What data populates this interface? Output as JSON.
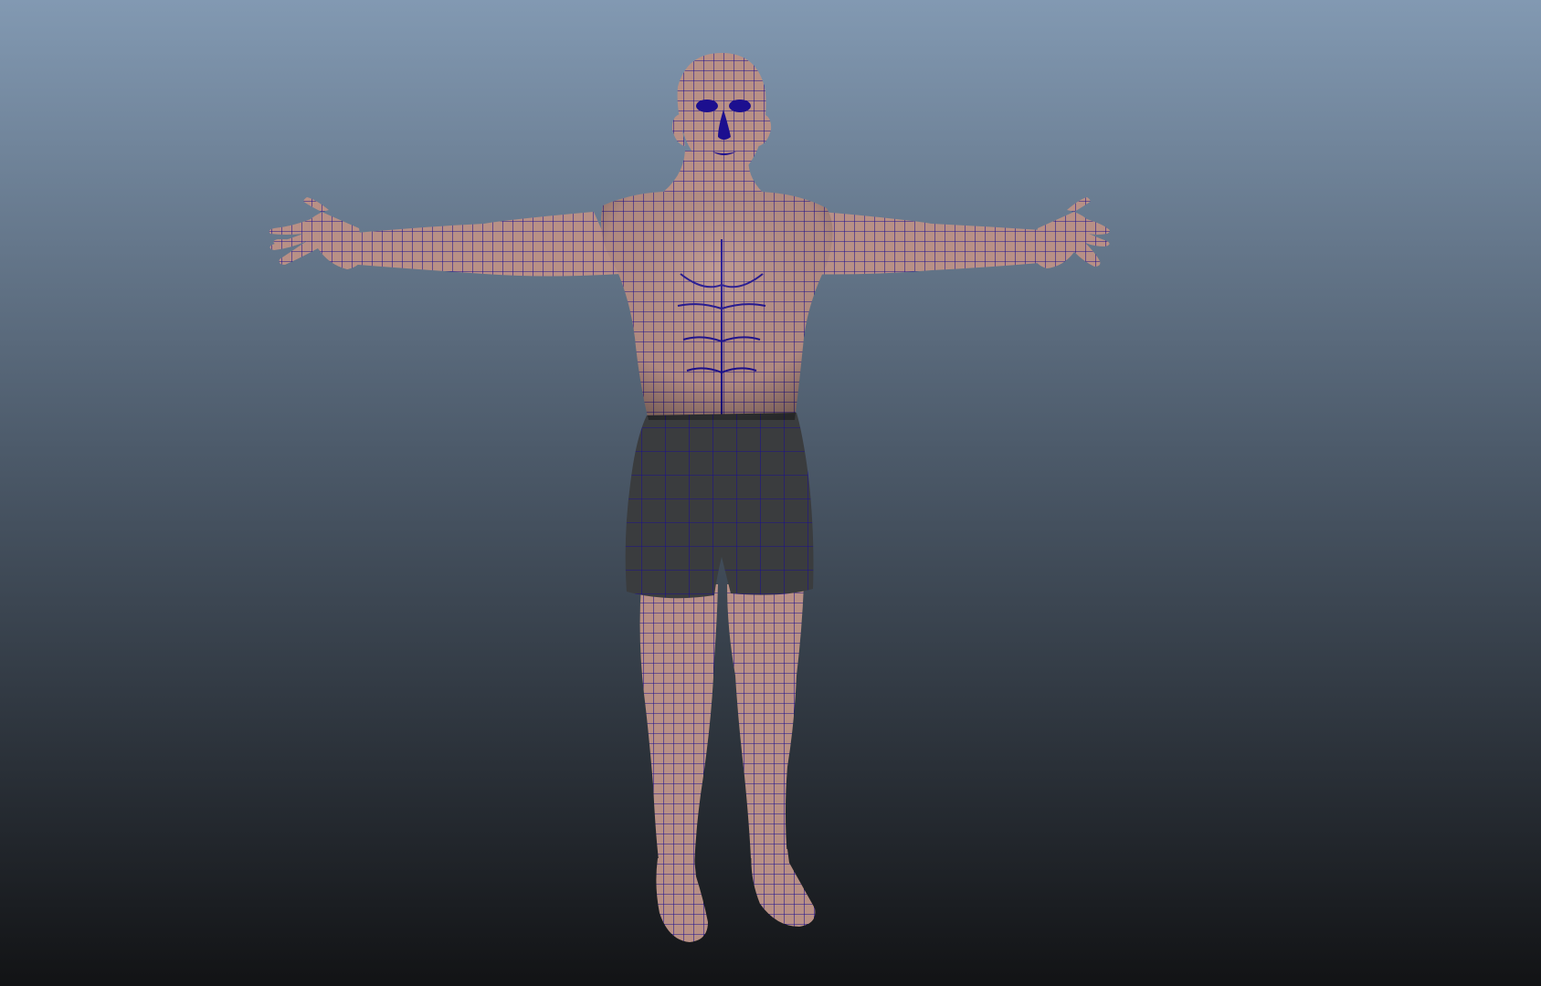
{
  "viewport": {
    "background": {
      "top_color": "#8299b2",
      "mid_color": "#4d5b6b",
      "bottom_color": "#121315"
    },
    "model": {
      "skin_color": "#b89086",
      "skin_shadow_color": "#6f5762",
      "shorts_color": "#3a3c3e",
      "wire_color": "#1c0f8f"
    }
  }
}
